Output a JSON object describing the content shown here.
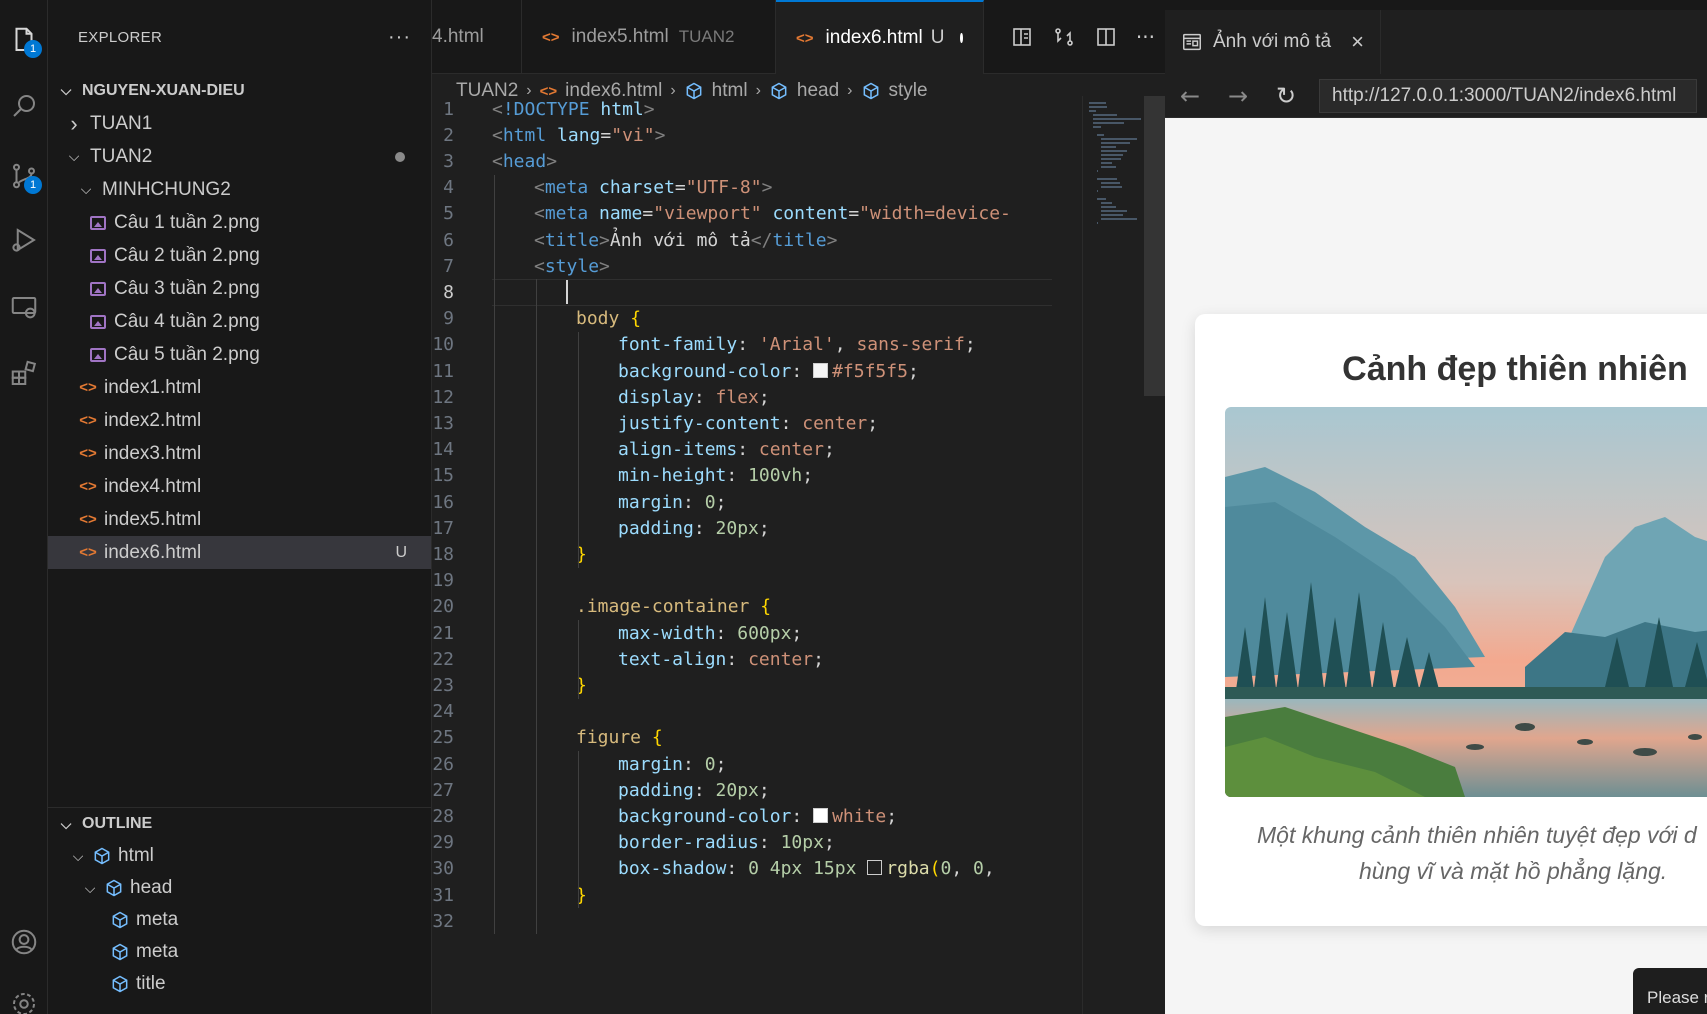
{
  "activity_bar": {
    "explorer_badge": "1",
    "scm_badge": "1"
  },
  "explorer": {
    "title": "EXPLORER",
    "more": "···",
    "root": "NGUYEN-XUAN-DIEU",
    "items": [
      {
        "label": "TUAN1",
        "type": "folder",
        "level": 1,
        "expanded": false
      },
      {
        "label": "TUAN2",
        "type": "folder",
        "level": 1,
        "expanded": true,
        "dot": true
      },
      {
        "label": "MINHCHUNG2",
        "type": "folder",
        "level": 2,
        "expanded": true
      },
      {
        "label": "Câu 1 tuần 2.png",
        "type": "image",
        "level": 3
      },
      {
        "label": "Câu 2 tuần 2.png",
        "type": "image",
        "level": 3
      },
      {
        "label": "Câu 3 tuần 2.png",
        "type": "image",
        "level": 3
      },
      {
        "label": "Câu 4 tuần 2.png",
        "type": "image",
        "level": 3
      },
      {
        "label": "Câu 5 tuần 2.png",
        "type": "image",
        "level": 3
      },
      {
        "label": "index1.html",
        "type": "html",
        "level": 2
      },
      {
        "label": "index2.html",
        "type": "html",
        "level": 2
      },
      {
        "label": "index3.html",
        "type": "html",
        "level": 2
      },
      {
        "label": "index4.html",
        "type": "html",
        "level": 2
      },
      {
        "label": "index5.html",
        "type": "html",
        "level": 2
      },
      {
        "label": "index6.html",
        "type": "html",
        "level": 2,
        "selected": true,
        "badge": "U"
      }
    ]
  },
  "outline": {
    "title": "OUTLINE",
    "items": [
      {
        "label": "html",
        "level": 1
      },
      {
        "label": "head",
        "level": 2
      },
      {
        "label": "meta",
        "level": 3
      },
      {
        "label": "meta",
        "level": 3
      },
      {
        "label": "title",
        "level": 3
      }
    ]
  },
  "editor": {
    "tabs": [
      {
        "label": "4.html",
        "sub": ""
      },
      {
        "label": "index5.html",
        "sub": "TUAN2"
      },
      {
        "label": "index6.html",
        "sub": "",
        "modified": "U",
        "active": true
      }
    ],
    "breadcrumb": [
      "TUAN2",
      "index6.html",
      "html",
      "head",
      "style"
    ],
    "current_line": 8,
    "lines": [
      {
        "n": 1,
        "indent": 0,
        "tokens": [
          [
            "t-br",
            "<"
          ],
          [
            "t-tag",
            "!DOCTYPE"
          ],
          [
            "t-txt",
            " "
          ],
          [
            "t-attr",
            "html"
          ],
          [
            "t-br",
            ">"
          ]
        ]
      },
      {
        "n": 2,
        "indent": 0,
        "tokens": [
          [
            "t-br",
            "<"
          ],
          [
            "t-tag",
            "html"
          ],
          [
            "t-txt",
            " "
          ],
          [
            "t-attr",
            "lang"
          ],
          [
            "t-txt",
            "="
          ],
          [
            "t-str",
            "\"vi\""
          ],
          [
            "t-br",
            ">"
          ]
        ]
      },
      {
        "n": 3,
        "indent": 0,
        "tokens": [
          [
            "t-br",
            "<"
          ],
          [
            "t-tag",
            "head"
          ],
          [
            "t-br",
            ">"
          ]
        ]
      },
      {
        "n": 4,
        "indent": 1,
        "tokens": [
          [
            "t-br",
            "<"
          ],
          [
            "t-tag",
            "meta"
          ],
          [
            "t-txt",
            " "
          ],
          [
            "t-attr",
            "charset"
          ],
          [
            "t-txt",
            "="
          ],
          [
            "t-str",
            "\"UTF-8\""
          ],
          [
            "t-br",
            ">"
          ]
        ]
      },
      {
        "n": 5,
        "indent": 1,
        "tokens": [
          [
            "t-br",
            "<"
          ],
          [
            "t-tag",
            "meta"
          ],
          [
            "t-txt",
            " "
          ],
          [
            "t-attr",
            "name"
          ],
          [
            "t-txt",
            "="
          ],
          [
            "t-str",
            "\"viewport\""
          ],
          [
            "t-txt",
            " "
          ],
          [
            "t-attr",
            "content"
          ],
          [
            "t-txt",
            "="
          ],
          [
            "t-str",
            "\"width=device-"
          ]
        ]
      },
      {
        "n": 6,
        "indent": 1,
        "tokens": [
          [
            "t-br",
            "<"
          ],
          [
            "t-tag",
            "title"
          ],
          [
            "t-br",
            ">"
          ],
          [
            "t-txt",
            "Ảnh với mô tả"
          ],
          [
            "t-br",
            "</"
          ],
          [
            "t-tag",
            "title"
          ],
          [
            "t-br",
            ">"
          ]
        ]
      },
      {
        "n": 7,
        "indent": 1,
        "tokens": [
          [
            "t-br",
            "<"
          ],
          [
            "t-tag",
            "style"
          ],
          [
            "t-br",
            ">"
          ]
        ]
      },
      {
        "n": 8,
        "indent": 2,
        "tokens": []
      },
      {
        "n": 9,
        "indent": 2,
        "tokens": [
          [
            "t-sel",
            "body"
          ],
          [
            "t-txt",
            " "
          ],
          [
            "t-brace",
            "{"
          ]
        ]
      },
      {
        "n": 10,
        "indent": 3,
        "tokens": [
          [
            "t-prop",
            "font-family"
          ],
          [
            "t-txt",
            ": "
          ],
          [
            "t-val",
            "'Arial'"
          ],
          [
            "t-txt",
            ", "
          ],
          [
            "t-val",
            "sans-serif"
          ],
          [
            "t-txt",
            ";"
          ]
        ]
      },
      {
        "n": 11,
        "indent": 3,
        "tokens": [
          [
            "t-prop",
            "background-color"
          ],
          [
            "t-txt",
            ": "
          ],
          [
            "swatch",
            "#f5f5f5"
          ],
          [
            "t-val",
            "#f5f5f5"
          ],
          [
            "t-txt",
            ";"
          ]
        ]
      },
      {
        "n": 12,
        "indent": 3,
        "tokens": [
          [
            "t-prop",
            "display"
          ],
          [
            "t-txt",
            ": "
          ],
          [
            "t-val",
            "flex"
          ],
          [
            "t-txt",
            ";"
          ]
        ]
      },
      {
        "n": 13,
        "indent": 3,
        "tokens": [
          [
            "t-prop",
            "justify-content"
          ],
          [
            "t-txt",
            ": "
          ],
          [
            "t-val",
            "center"
          ],
          [
            "t-txt",
            ";"
          ]
        ]
      },
      {
        "n": 14,
        "indent": 3,
        "tokens": [
          [
            "t-prop",
            "align-items"
          ],
          [
            "t-txt",
            ": "
          ],
          [
            "t-val",
            "center"
          ],
          [
            "t-txt",
            ";"
          ]
        ]
      },
      {
        "n": 15,
        "indent": 3,
        "tokens": [
          [
            "t-prop",
            "min-height"
          ],
          [
            "t-txt",
            ": "
          ],
          [
            "t-num",
            "100vh"
          ],
          [
            "t-txt",
            ";"
          ]
        ]
      },
      {
        "n": 16,
        "indent": 3,
        "tokens": [
          [
            "t-prop",
            "margin"
          ],
          [
            "t-txt",
            ": "
          ],
          [
            "t-num",
            "0"
          ],
          [
            "t-txt",
            ";"
          ]
        ]
      },
      {
        "n": 17,
        "indent": 3,
        "tokens": [
          [
            "t-prop",
            "padding"
          ],
          [
            "t-txt",
            ": "
          ],
          [
            "t-num",
            "20px"
          ],
          [
            "t-txt",
            ";"
          ]
        ]
      },
      {
        "n": 18,
        "indent": 2,
        "tokens": [
          [
            "t-brace",
            "}"
          ]
        ]
      },
      {
        "n": 19,
        "indent": 2,
        "tokens": []
      },
      {
        "n": 20,
        "indent": 2,
        "tokens": [
          [
            "t-sel",
            ".image-container"
          ],
          [
            "t-txt",
            " "
          ],
          [
            "t-brace",
            "{"
          ]
        ]
      },
      {
        "n": 21,
        "indent": 3,
        "tokens": [
          [
            "t-prop",
            "max-width"
          ],
          [
            "t-txt",
            ": "
          ],
          [
            "t-num",
            "600px"
          ],
          [
            "t-txt",
            ";"
          ]
        ]
      },
      {
        "n": 22,
        "indent": 3,
        "tokens": [
          [
            "t-prop",
            "text-align"
          ],
          [
            "t-txt",
            ": "
          ],
          [
            "t-val",
            "center"
          ],
          [
            "t-txt",
            ";"
          ]
        ]
      },
      {
        "n": 23,
        "indent": 2,
        "tokens": [
          [
            "t-brace",
            "}"
          ]
        ]
      },
      {
        "n": 24,
        "indent": 2,
        "tokens": []
      },
      {
        "n": 25,
        "indent": 2,
        "tokens": [
          [
            "t-sel",
            "figure"
          ],
          [
            "t-txt",
            " "
          ],
          [
            "t-brace",
            "{"
          ]
        ]
      },
      {
        "n": 26,
        "indent": 3,
        "tokens": [
          [
            "t-prop",
            "margin"
          ],
          [
            "t-txt",
            ": "
          ],
          [
            "t-num",
            "0"
          ],
          [
            "t-txt",
            ";"
          ]
        ]
      },
      {
        "n": 27,
        "indent": 3,
        "tokens": [
          [
            "t-prop",
            "padding"
          ],
          [
            "t-txt",
            ": "
          ],
          [
            "t-num",
            "20px"
          ],
          [
            "t-txt",
            ";"
          ]
        ]
      },
      {
        "n": 28,
        "indent": 3,
        "tokens": [
          [
            "t-prop",
            "background-color"
          ],
          [
            "t-txt",
            ": "
          ],
          [
            "swatch",
            "#ffffff"
          ],
          [
            "t-val",
            "white"
          ],
          [
            "t-txt",
            ";"
          ]
        ]
      },
      {
        "n": 29,
        "indent": 3,
        "tokens": [
          [
            "t-prop",
            "border-radius"
          ],
          [
            "t-txt",
            ": "
          ],
          [
            "t-num",
            "10px"
          ],
          [
            "t-txt",
            ";"
          ]
        ]
      },
      {
        "n": 30,
        "indent": 3,
        "tokens": [
          [
            "t-prop",
            "box-shadow"
          ],
          [
            "t-txt",
            ": "
          ],
          [
            "t-num",
            "0 4px 15px"
          ],
          [
            "t-txt",
            " "
          ],
          [
            "swatch",
            "#1f1f1f"
          ],
          [
            "t-fn",
            "rgba"
          ],
          [
            "t-brace",
            "("
          ],
          [
            "t-num",
            "0"
          ],
          [
            "t-txt",
            ", "
          ],
          [
            "t-num",
            "0"
          ],
          [
            "t-txt",
            ","
          ]
        ]
      },
      {
        "n": 31,
        "indent": 2,
        "tokens": [
          [
            "t-brace",
            "}"
          ]
        ]
      },
      {
        "n": 32,
        "indent": 2,
        "tokens": []
      }
    ]
  },
  "browser": {
    "tab_title": "Ảnh với mô tả",
    "url": "http://127.0.0.1:3000/TUAN2/index6.html",
    "page": {
      "heading": "Cảnh đẹp thiên nhiên",
      "caption_line1": "Một khung cảnh thiên nhiên tuyệt đẹp với d",
      "caption_line2": "hùng vĩ và mặt hồ phẳng lặng."
    },
    "toast": "Please r"
  },
  "colors": {
    "accent": "#0078d4",
    "html_icon": "#e37933",
    "image_icon": "#a074c4",
    "outline_icon": "#75beff"
  }
}
